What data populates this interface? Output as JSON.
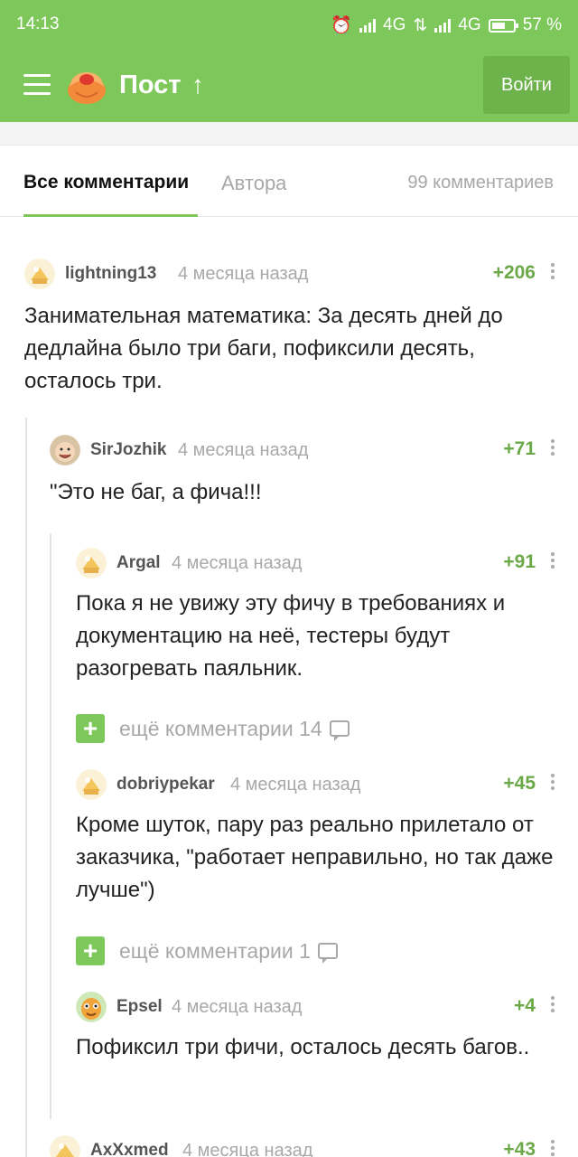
{
  "status_bar": {
    "time": "14:13",
    "net1": "4G",
    "net2": "4G",
    "battery": "57 %"
  },
  "header": {
    "title": "Пост",
    "up_arrow": "↑",
    "login_label": "Войти"
  },
  "tabs": {
    "all": "Все комментарии",
    "author": "Автора",
    "count": "99 комментариев"
  },
  "colors": {
    "accent": "#7ec75a",
    "rating": "#6ba848",
    "muted": "#a8a8a8"
  },
  "comments": [
    {
      "user": "lightning13",
      "time": "4 месяца назад",
      "rating": "+206",
      "text": "Занимательная математика: За десять дней до дедлайна было три баги, пофиксили десять, осталось три."
    },
    {
      "user": "SirJozhik",
      "time": "4 месяца назад",
      "rating": "+71",
      "text": "\"Это не баг, а фича!!!"
    },
    {
      "user": "Argal",
      "time": "4 месяца назад",
      "rating": "+91",
      "text": "Пока я не увижу эту фичу в требованиях и документацию на неё, тестеры будут разогревать паяльник."
    },
    {
      "user": "dobriypekar",
      "time": "4 месяца назад",
      "rating": "+45",
      "text": "Кроме шуток, пару раз реально прилетало от заказчика, \"работает неправильно, но так даже лучше\")"
    },
    {
      "user": "Epsel",
      "time": "4 месяца назад",
      "rating": "+4",
      "text": "Пофиксил три фичи, осталось десять багов.."
    },
    {
      "user": "AxXxmed",
      "time": "4 месяца назад",
      "rating": "+43",
      "text": ""
    }
  ],
  "more_links": [
    {
      "label": "ещё комментарии 14"
    },
    {
      "label": "ещё комментарии 1"
    }
  ]
}
